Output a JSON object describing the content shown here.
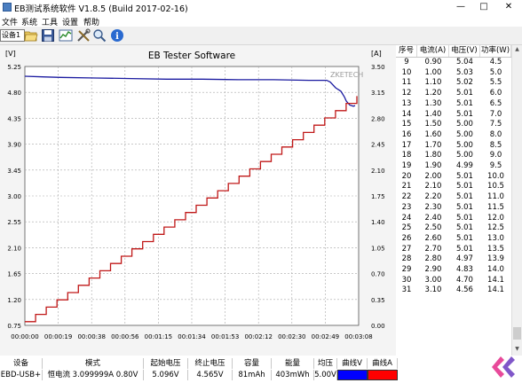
{
  "window": {
    "title": "EB测试系统软件 V1.8.5 (Build 2017-02-16)",
    "minimize": "—",
    "maximize": "□",
    "close": "✕"
  },
  "menu": [
    "文件",
    "系统",
    "工具",
    "设置",
    "帮助"
  ],
  "toolbar": {
    "device_combo": "设备1",
    "icons": [
      "open-icon",
      "save-icon",
      "chart-icon",
      "tools-icon",
      "search-icon",
      "info-icon"
    ]
  },
  "chart_data": {
    "type": "line",
    "title": "EB Tester Software",
    "watermark": "ZKETECH",
    "left_unit": "[V]",
    "right_unit": "[A]",
    "y_left_ticks": [
      "5.25",
      "4.80",
      "4.35",
      "3.90",
      "3.45",
      "3.00",
      "2.55",
      "2.10",
      "1.65",
      "1.20",
      "0.75"
    ],
    "y_right_ticks": [
      "3.50",
      "3.15",
      "2.80",
      "2.45",
      "2.10",
      "1.75",
      "1.40",
      "1.05",
      "0.70",
      "0.35",
      "0.00"
    ],
    "x_ticks": [
      "00:00:00",
      "00:00:19",
      "00:00:38",
      "00:00:56",
      "00:01:15",
      "00:01:34",
      "00:01:53",
      "00:02:12",
      "00:02:30",
      "00:02:49",
      "00:03:08"
    ],
    "ylim_left": [
      0.75,
      5.25
    ],
    "ylim_right": [
      0,
      3.5
    ],
    "xlim_seconds": [
      0,
      188
    ],
    "series": [
      {
        "color": "#1a1aa0",
        "axis": "left",
        "x_seconds": [
          0,
          10,
          20,
          40,
          60,
          80,
          100,
          120,
          140,
          160,
          170,
          172,
          175,
          178,
          180,
          181,
          183,
          185,
          186
        ],
        "values": [
          5.08,
          5.07,
          5.06,
          5.05,
          5.04,
          5.03,
          5.03,
          5.02,
          5.02,
          5.01,
          5.01,
          4.98,
          4.88,
          4.82,
          4.72,
          4.65,
          4.58,
          4.56,
          4.57
        ]
      },
      {
        "color": "#c01818",
        "axis": "right",
        "step": true,
        "x_seconds": [
          0,
          187
        ],
        "values": [
          0.05,
          3.1
        ]
      }
    ],
    "grid": true
  },
  "table": {
    "headers": [
      "序号",
      "电流(A)",
      "电压(V)",
      "功率(W)"
    ],
    "rows": [
      [
        "9",
        "0.90",
        "5.04",
        "4.5"
      ],
      [
        "10",
        "1.00",
        "5.03",
        "5.0"
      ],
      [
        "11",
        "1.10",
        "5.02",
        "5.5"
      ],
      [
        "12",
        "1.20",
        "5.01",
        "6.0"
      ],
      [
        "13",
        "1.30",
        "5.01",
        "6.5"
      ],
      [
        "14",
        "1.40",
        "5.01",
        "7.0"
      ],
      [
        "15",
        "1.50",
        "5.00",
        "7.5"
      ],
      [
        "16",
        "1.60",
        "5.00",
        "8.0"
      ],
      [
        "17",
        "1.70",
        "5.00",
        "8.5"
      ],
      [
        "18",
        "1.80",
        "5.00",
        "9.0"
      ],
      [
        "19",
        "1.90",
        "4.99",
        "9.5"
      ],
      [
        "20",
        "2.00",
        "5.01",
        "10.0"
      ],
      [
        "21",
        "2.10",
        "5.01",
        "10.5"
      ],
      [
        "22",
        "2.20",
        "5.01",
        "11.0"
      ],
      [
        "23",
        "2.30",
        "5.01",
        "11.5"
      ],
      [
        "24",
        "2.40",
        "5.01",
        "12.0"
      ],
      [
        "25",
        "2.50",
        "5.01",
        "12.5"
      ],
      [
        "26",
        "2.60",
        "5.01",
        "13.0"
      ],
      [
        "27",
        "2.70",
        "5.01",
        "13.5"
      ],
      [
        "28",
        "2.80",
        "4.97",
        "13.9"
      ],
      [
        "29",
        "2.90",
        "4.83",
        "14.0"
      ],
      [
        "30",
        "3.00",
        "4.70",
        "14.1"
      ],
      [
        "31",
        "3.10",
        "4.56",
        "14.1"
      ]
    ]
  },
  "status": {
    "headers": [
      "设备",
      "模式",
      "起始电压",
      "终止电压",
      "容量",
      "能量",
      "均压",
      "曲线V",
      "曲线A"
    ],
    "values": [
      "EBD-USB+",
      "恒电流  3.099999A  0.80V",
      "5.096V",
      "4.565V",
      "81mAh",
      "403mWh",
      "5.00V",
      "",
      ""
    ],
    "curve_v_color": "#0000ff",
    "curve_a_color": "#ff0000"
  }
}
